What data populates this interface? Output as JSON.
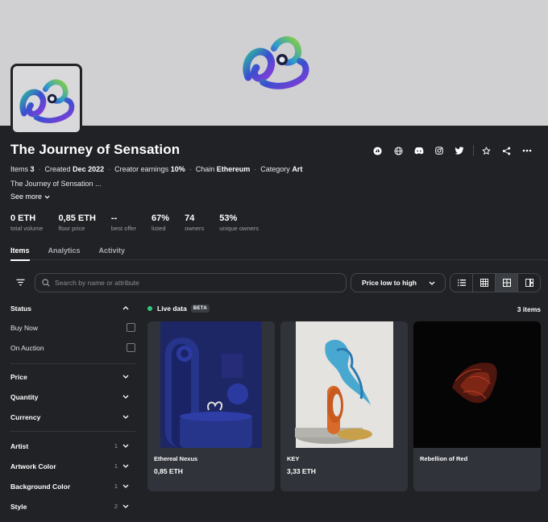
{
  "collection": {
    "title": "The Journey of Sensation",
    "description": "The Journey of Sensation ...",
    "see_more": "See more"
  },
  "meta": [
    {
      "label": "Items",
      "value": "3"
    },
    {
      "label": "Created",
      "value": "Dec 2022"
    },
    {
      "label": "Creator earnings",
      "value": "10%"
    },
    {
      "label": "Chain",
      "value": "Ethereum"
    },
    {
      "label": "Category",
      "value": "Art"
    }
  ],
  "social_icons": [
    "opensea-icon",
    "globe-icon",
    "discord-icon",
    "instagram-icon",
    "twitter-icon",
    "star-icon",
    "share-icon",
    "more-icon"
  ],
  "stats": [
    {
      "value": "0 ETH",
      "label": "total volume"
    },
    {
      "value": "0,85 ETH",
      "label": "floor price"
    },
    {
      "value": "--",
      "label": "best offer"
    },
    {
      "value": "67%",
      "label": "listed"
    },
    {
      "value": "74",
      "label": "owners"
    },
    {
      "value": "53%",
      "label": "unique owners"
    }
  ],
  "tabs": [
    "Items",
    "Analytics",
    "Activity"
  ],
  "search": {
    "placeholder": "Search by name or attribute"
  },
  "sort": {
    "label": "Price low to high"
  },
  "filters": {
    "status": {
      "label": "Status",
      "options": [
        "Buy Now",
        "On Auction"
      ]
    },
    "groups": [
      "Price",
      "Quantity",
      "Currency"
    ],
    "traits": [
      {
        "label": "Artist",
        "count": "1"
      },
      {
        "label": "Artwork Color",
        "count": "1"
      },
      {
        "label": "Background Color",
        "count": "1"
      },
      {
        "label": "Style",
        "count": "2"
      }
    ]
  },
  "live": {
    "label": "Live data",
    "badge": "BETA",
    "count": "3 items"
  },
  "items": [
    {
      "name": "Ethereal Nexus",
      "price": "0,85 ETH"
    },
    {
      "name": "KEY",
      "price": "3,33 ETH"
    },
    {
      "name": "Rebellion of Red",
      "price": ""
    }
  ],
  "colors": {
    "background": "#202225",
    "banner": "#d0d0d3",
    "card": "#303339",
    "accent_green": "#34c77b"
  }
}
